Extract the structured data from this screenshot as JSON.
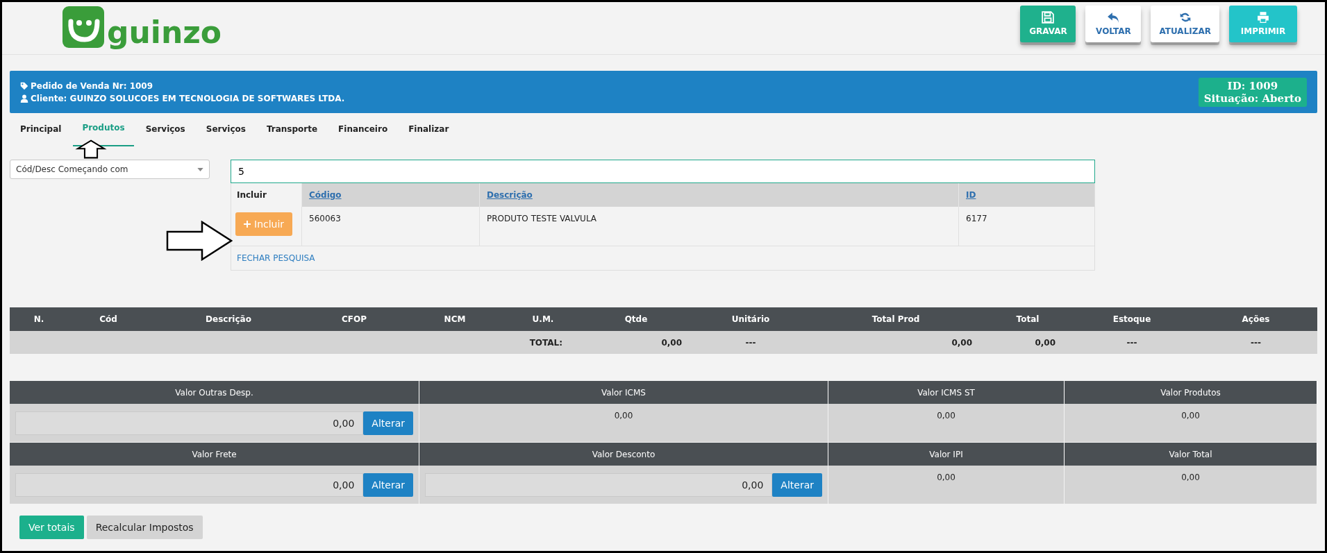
{
  "header": {
    "logo_text": "guinzo",
    "buttons": [
      {
        "label": "GRAVAR",
        "kind": "save"
      },
      {
        "label": "VOLTAR",
        "kind": "back"
      },
      {
        "label": "ATUALIZAR",
        "kind": "refresh"
      },
      {
        "label": "IMPRIMIR",
        "kind": "print"
      }
    ]
  },
  "order_banner": {
    "order_line": "Pedido de Venda Nr: 1009",
    "client_line": "Cliente: GUINZO SOLUCOES EM TECNOLOGIA DE SOFTWARES LTDA.",
    "id_line": "ID: 1009",
    "status_line": "Situação: Aberto"
  },
  "tabs": [
    {
      "label": "Principal",
      "selected": false
    },
    {
      "label": "Produtos",
      "selected": true
    },
    {
      "label": "Serviços",
      "selected": false
    },
    {
      "label": "Serviços",
      "selected": false
    },
    {
      "label": "Transporte",
      "selected": false
    },
    {
      "label": "Financeiro",
      "selected": false
    },
    {
      "label": "Finalizar",
      "selected": false
    }
  ],
  "search": {
    "mode": "Cód/Desc Começando com",
    "value": "5",
    "results": {
      "columns": [
        "Incluir",
        "Código",
        "Descrição",
        "ID"
      ],
      "rows": [
        {
          "button": "Incluir",
          "codigo": "560063",
          "descricao": "PRODUTO TESTE VALVULA",
          "id": "6177"
        }
      ],
      "close_link": "FECHAR PESQUISA"
    }
  },
  "items_table": {
    "columns": [
      "N.",
      "Cód",
      "Descrição",
      "CFOP",
      "NCM",
      "U.M.",
      "Qtde",
      "Unitário",
      "Total Prod",
      "Total",
      "Estoque",
      "Ações"
    ],
    "total_row": [
      "TOTAL:",
      "0,00",
      "---",
      "0,00",
      "0,00",
      "---",
      "---"
    ]
  },
  "totals": [
    {
      "label": "Valor Outras Desp.",
      "value": "0,00",
      "kind": "editable",
      "button": "Alterar"
    },
    {
      "label": "Valor ICMS",
      "value": "0,00",
      "kind": "readonly"
    },
    {
      "label": "Valor ICMS ST",
      "value": "0,00",
      "kind": "readonly"
    },
    {
      "label": "Valor Produtos",
      "value": "0,00",
      "kind": "readonly"
    },
    {
      "label": "Valor Frete",
      "value": "0,00",
      "kind": "editable",
      "button": "Alterar"
    },
    {
      "label": "Valor Desconto",
      "value": "0,00",
      "kind": "editable",
      "button": "Alterar"
    },
    {
      "label": "Valor IPI",
      "value": "0,00",
      "kind": "readonly"
    },
    {
      "label": "Valor Total",
      "value": "0,00",
      "kind": "readonly"
    }
  ],
  "footer_buttons": [
    {
      "label": "Ver totais",
      "kind": "primary"
    },
    {
      "label": "Recalcular Impostos",
      "kind": "secondary"
    }
  ]
}
